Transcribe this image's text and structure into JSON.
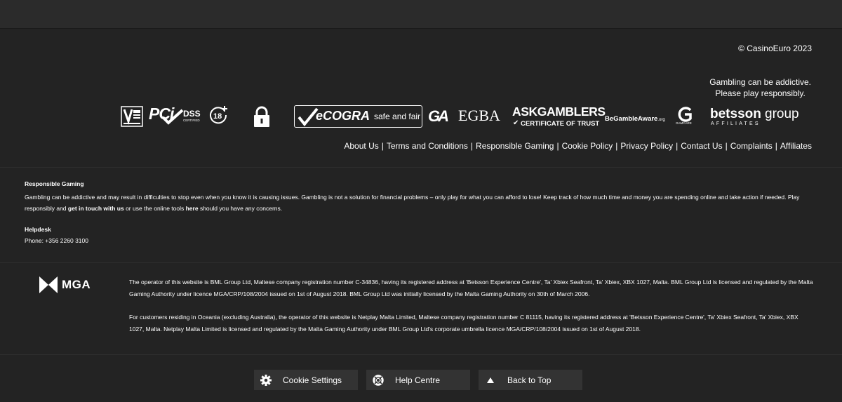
{
  "footer": {
    "copyright": "© CasinoEuro 2023",
    "gambling_note_line1": "Gambling can be addictive.",
    "gambling_note_line2": "Please play responsibly.",
    "logos": {
      "pci": "PCi",
      "dss": "DSS",
      "dss_sub": "CERTIFIED",
      "age": "18",
      "ecogra": "eCOGRA",
      "ecogra_sub": "safe and fair",
      "ga": "GA",
      "egba": "EGBA",
      "askgamblers": "ASKGAMBLERS",
      "askgamblers_sub": "CERTIFICATE OF TRUST",
      "begambleaware": "BeGambleAware",
      "begambleaware_org": ".org",
      "gamcare": "GAMCARE",
      "betsson_main": "betsson",
      "betsson_group": "group",
      "betsson_sub": "AFFILIATES"
    },
    "links": [
      "About Us",
      "Terms and Conditions",
      "Responsible Gaming",
      "Cookie Policy",
      "Privacy Policy",
      "Contact Us",
      "Complaints",
      "Affiliates"
    ],
    "separator": "|",
    "responsible": {
      "title": "Responsible Gaming",
      "text_part1": "Gambling can be addictive and may result in difficulties to stop even when you know it is causing issues. Gambling is not a solution for financial problems – only play for what you can afford to lose! Keep track of how much time and money you are spending online and take action if needed. Play responsibly and ",
      "link1": "get in touch with us",
      "text_part2": " or use the online tools ",
      "link2": "here",
      "text_part3": " should you have any concerns."
    },
    "helpdesk": {
      "title": "Helpdesk",
      "phone": "Phone: +356 2260 3100"
    },
    "mga_label": "MGA",
    "operator_para1": "The operator of this website is BML Group Ltd, Maltese company registration number C-34836, having its registered address at 'Betsson Experience Centre', Ta' Xbiex Seafront, Ta' Xbiex, XBX 1027, Malta. BML Group Ltd is licensed and regulated by the Malta Gaming Authority under licence MGA/CRP/108/2004 issued on 1st of August 2018. BML Group Ltd was initially licensed by the Malta Gaming Authority on 30th of March 2006.",
    "operator_para2": "For customers residing in Oceania (excluding Australia), the operator of this website is Netplay Malta Limited, Maltese company registration number C 81115, having its registered address at 'Betsson Experience Centre', Ta' Xbiex Seafront, Ta' Xbiex, XBX 1027, Malta. Netplay Malta Limited is licensed and regulated by the Malta Gaming Authority under BML Group Ltd's corporate umbrella licence MGA/CRP/108/2004 issued on 1st of August 2018.",
    "buttons": {
      "cookie": "Cookie Settings",
      "help": "Help Centre",
      "top": "Back to Top"
    }
  },
  "icons": {
    "cookie": "gear-icon",
    "help": "lifebuoy-icon",
    "top": "arrow-up-icon",
    "lock": "lock-icon"
  },
  "colors": {
    "background": "#232323",
    "topbar": "#2b2b2b",
    "button": "#333333",
    "text": "#ffffff"
  }
}
